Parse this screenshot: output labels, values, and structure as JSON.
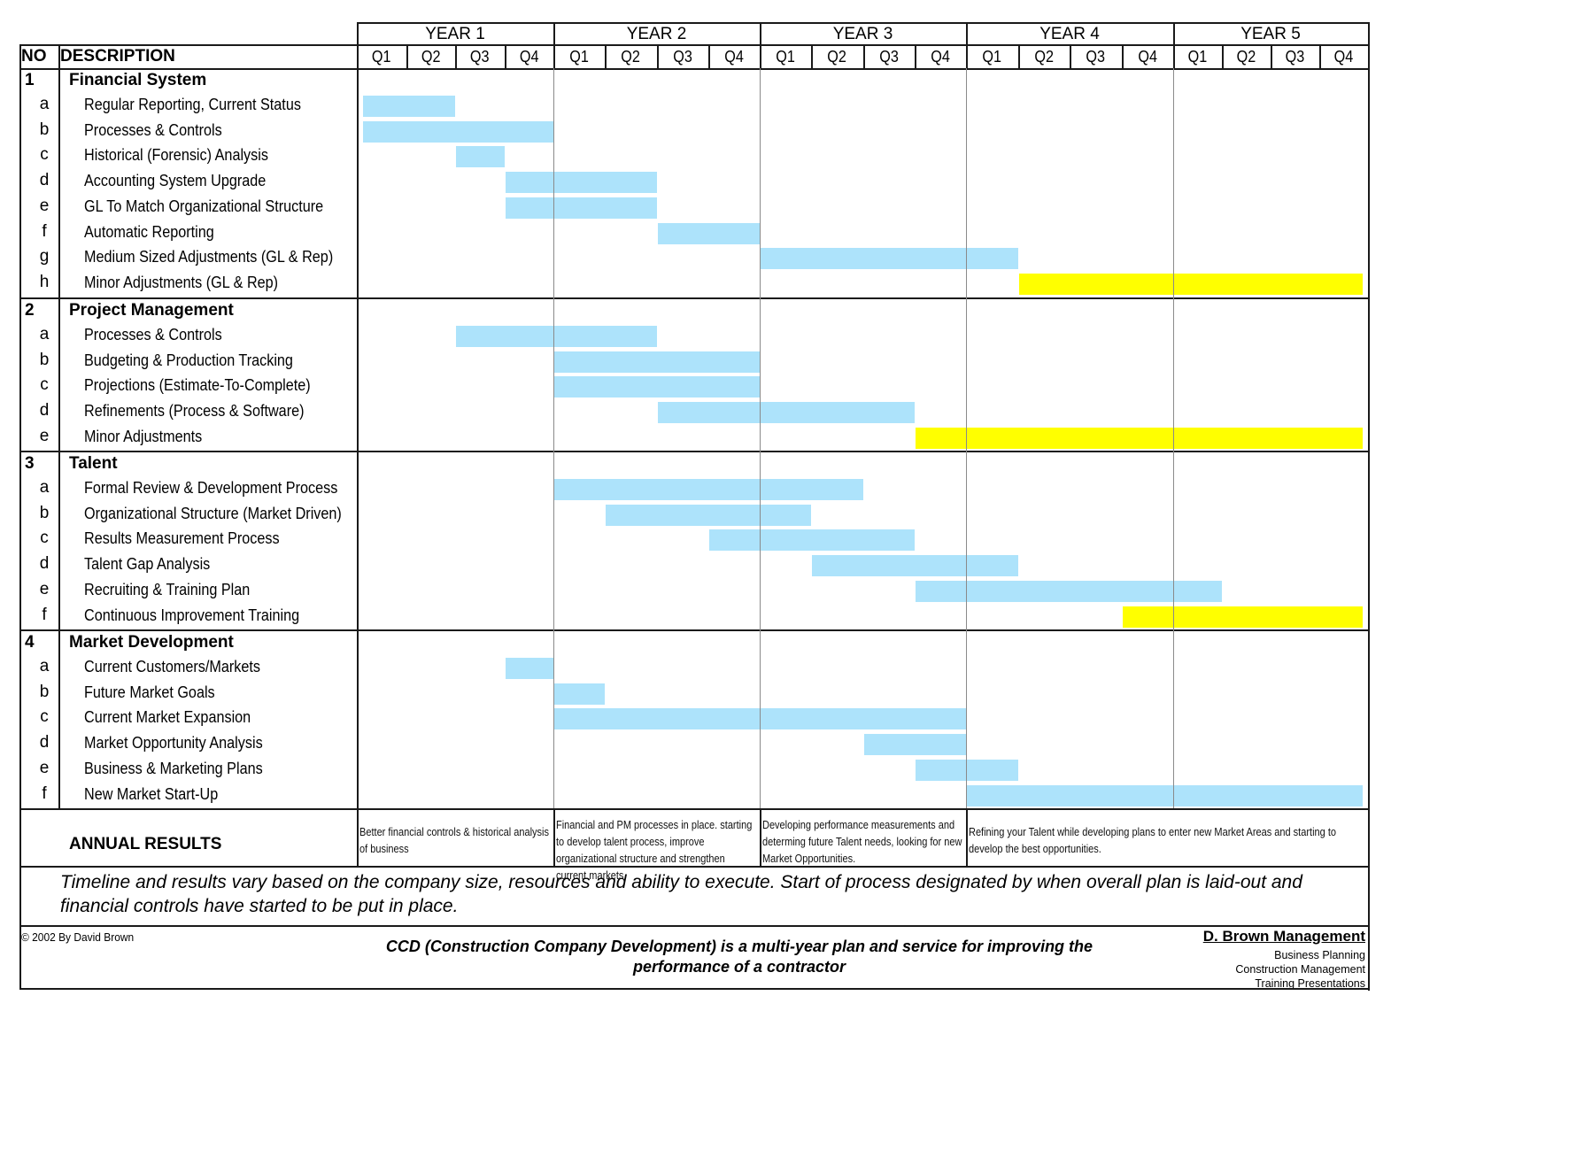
{
  "chart_data": {
    "type": "gantt",
    "title": "CCD (Construction Company Development) multi-year plan",
    "columns": {
      "no_label": "NO",
      "description_label": "DESCRIPTION"
    },
    "years": [
      "YEAR 1",
      "YEAR 2",
      "YEAR 3",
      "YEAR 4",
      "YEAR 5"
    ],
    "quarters": [
      "Q1",
      "Q2",
      "Q3",
      "Q4"
    ],
    "time_unit": "quarter",
    "time_range": [
      0,
      20
    ],
    "colors": {
      "standard": "#ade3fb",
      "ongoing": "#ffff00"
    },
    "sections": [
      {
        "no": "1",
        "title": "Financial System",
        "items": [
          {
            "no": "a",
            "label": "Regular Reporting, Current Status",
            "start": 0,
            "end": 2,
            "kind": "standard"
          },
          {
            "no": "b",
            "label": "Processes & Controls",
            "start": 0,
            "end": 4,
            "kind": "standard"
          },
          {
            "no": "c",
            "label": "Historical (Forensic) Analysis",
            "start": 2,
            "end": 3,
            "kind": "standard"
          },
          {
            "no": "d",
            "label": "Accounting System Upgrade",
            "start": 3,
            "end": 6,
            "kind": "standard"
          },
          {
            "no": "e",
            "label": "GL To Match Organizational Structure",
            "start": 3,
            "end": 6,
            "kind": "standard"
          },
          {
            "no": "f",
            "label": "Automatic Reporting",
            "start": 6,
            "end": 8,
            "kind": "standard"
          },
          {
            "no": "g",
            "label": "Medium Sized Adjustments (GL & Rep)",
            "start": 8,
            "end": 13,
            "kind": "standard"
          },
          {
            "no": "h",
            "label": "Minor Adjustments (GL & Rep)",
            "start": 13,
            "end": 20,
            "kind": "ongoing"
          }
        ]
      },
      {
        "no": "2",
        "title": "Project Management",
        "items": [
          {
            "no": "a",
            "label": "Processes & Controls",
            "start": 2,
            "end": 6,
            "kind": "standard"
          },
          {
            "no": "b",
            "label": "Budgeting & Production Tracking",
            "start": 4,
            "end": 8,
            "kind": "standard"
          },
          {
            "no": "c",
            "label": "Projections (Estimate-To-Complete)",
            "start": 4,
            "end": 8,
            "kind": "standard"
          },
          {
            "no": "d",
            "label": "Refinements (Process & Software)",
            "start": 6,
            "end": 11,
            "kind": "standard"
          },
          {
            "no": "e",
            "label": "Minor Adjustments",
            "start": 11,
            "end": 20,
            "kind": "ongoing"
          }
        ]
      },
      {
        "no": "3",
        "title": "Talent",
        "items": [
          {
            "no": "a",
            "label": "Formal Review & Development Process",
            "start": 4,
            "end": 10,
            "kind": "standard"
          },
          {
            "no": "b",
            "label": "Organizational Structure (Market Driven)",
            "start": 5,
            "end": 9,
            "kind": "standard"
          },
          {
            "no": "c",
            "label": "Results Measurement Process",
            "start": 7,
            "end": 11,
            "kind": "standard"
          },
          {
            "no": "d",
            "label": "Talent Gap Analysis",
            "start": 9,
            "end": 13,
            "kind": "standard"
          },
          {
            "no": "e",
            "label": "Recruiting & Training Plan",
            "start": 11,
            "end": 17,
            "kind": "standard"
          },
          {
            "no": "f",
            "label": "Continuous Improvement Training",
            "start": 15,
            "end": 20,
            "kind": "ongoing"
          }
        ]
      },
      {
        "no": "4",
        "title": "Market Development",
        "items": [
          {
            "no": "a",
            "label": "Current Customers/Markets",
            "start": 3,
            "end": 4,
            "kind": "standard"
          },
          {
            "no": "b",
            "label": "Future Market Goals",
            "start": 4,
            "end": 5,
            "kind": "standard"
          },
          {
            "no": "c",
            "label": "Current Market Expansion",
            "start": 4,
            "end": 12,
            "kind": "standard"
          },
          {
            "no": "d",
            "label": "Market Opportunity Analysis",
            "start": 10,
            "end": 12,
            "kind": "standard"
          },
          {
            "no": "e",
            "label": "Business & Marketing Plans",
            "start": 11,
            "end": 13,
            "kind": "standard"
          },
          {
            "no": "f",
            "label": "New Market Start-Up",
            "start": 12,
            "end": 20,
            "kind": "standard"
          }
        ]
      }
    ]
  },
  "annual_results": {
    "label": "ANNUAL RESULTS",
    "entries": [
      {
        "years": "YEAR 1",
        "text": "Better financial controls & historical analysis of business"
      },
      {
        "years": "YEAR 2",
        "text": "Financial and PM processes in place. starting to develop talent process, improve organizational structure and strengthen current markets"
      },
      {
        "years": "YEAR 3",
        "text": "Developing performance measurements and determing future Talent needs, looking for new Market Opportunities."
      },
      {
        "years": "YEAR 4-5",
        "text": "Refining your Talent while developing plans to enter new Market Areas and starting to develop the best opportunities."
      }
    ]
  },
  "note": "Timeline and results vary based on the company size, resources and ability to execute.  Start of process designated by when overall plan is laid-out and financial controls have started to be put in place.",
  "footer": {
    "copyright": "© 2002 By David Brown",
    "tagline": "CCD (Construction Company Development) is a multi-year plan and service for improving the performance of a contractor",
    "brand": "D. Brown Management",
    "services": [
      "Business Planning",
      "Construction Management",
      "Training Presentations"
    ]
  }
}
